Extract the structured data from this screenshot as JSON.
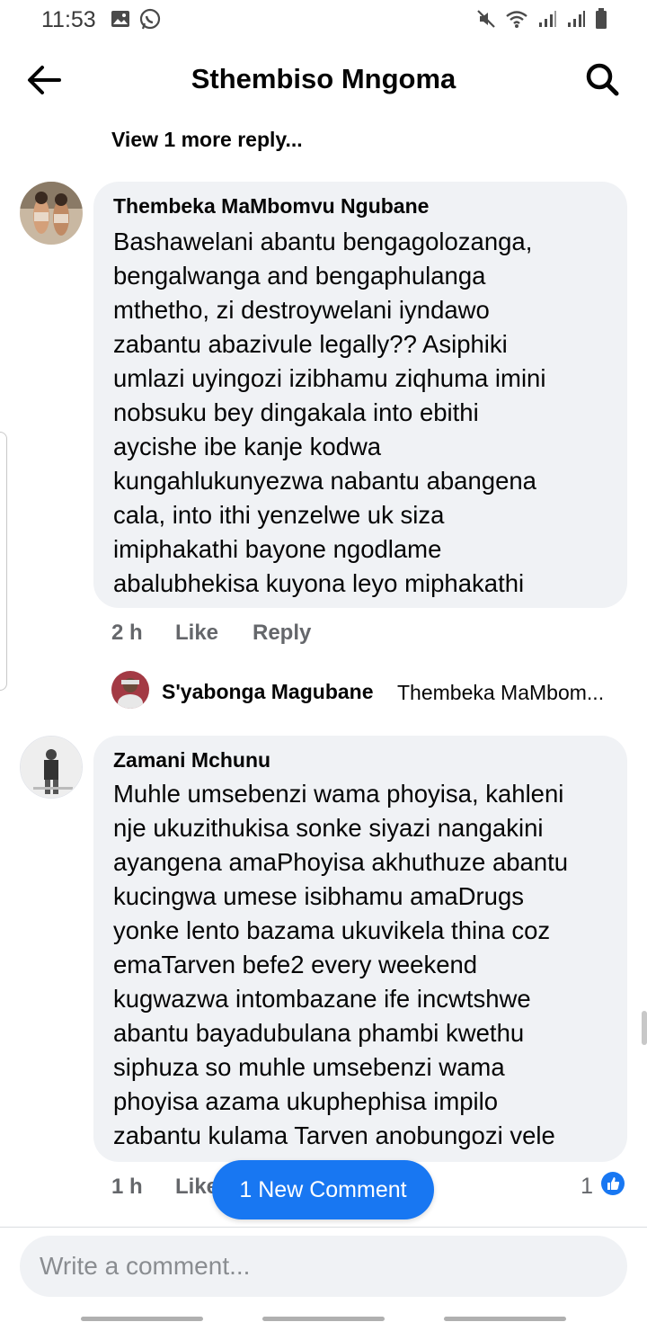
{
  "status_bar": {
    "time": "11:53",
    "left_icons": [
      "image-icon",
      "whatsapp-icon"
    ],
    "right_icons": [
      "mute-icon",
      "wifi-icon",
      "signal-icon",
      "signal-icon",
      "battery-icon"
    ]
  },
  "header": {
    "title": "Sthembiso Mngoma"
  },
  "view_more": "View 1 more reply...",
  "comments": [
    {
      "author": "Thembeka MaMbomvu Ngubane",
      "text": "Bashawelani abantu bengagolozanga,\nbengalwanga and bengaphulanga\nmthetho, zi destroywelani iyndawo\nzabantu abazivule legally?? Asiphiki\numlazi uyingozi izibhamu ziqhuma imini\nnobsuku bey dingakala into ebithi\naycishe ibe kanje kodwa\nkungahlukunyezwa nabantu abangena\ncala, into ithi yenzelwe uk siza\nimiphakathi bayone ngodlame\nabalubhekisa kuyona leyo miphakathi",
      "time": "2 h",
      "like_label": "Like",
      "reply_label": "Reply"
    },
    {
      "author": "Zamani Mchunu",
      "text": "Muhle umsebenzi wama phoyisa, kahleni\nnje ukuzithukisa sonke siyazi nangakini\nayangena amaPhoyisa akhuthuze abantu\nkucingwa umese isibhamu amaDrugs\nyonke lento bazama ukuvikela thina coz\nemaTarven befe2 every weekend\nkugwazwa intombazane ife incwtshwe\nabantu bayadubulana phambi kwethu\nsiphuza so muhle umsebenzi wama\nphoyisa azama ukuphephisa impilo\nzabantu kulama Tarven anobungozi vele",
      "time": "1 h",
      "like_label": "Like",
      "like_count": "1"
    }
  ],
  "reply_preview": {
    "author": "S'yabonga Magubane",
    "snippet": "Thembeka MaMbom..."
  },
  "new_comment_button": "1 New Comment",
  "composer": {
    "placeholder": "Write a comment..."
  },
  "colors": {
    "accent": "#1877f2",
    "bubble": "#f0f2f5",
    "meta_text": "#65676b"
  }
}
